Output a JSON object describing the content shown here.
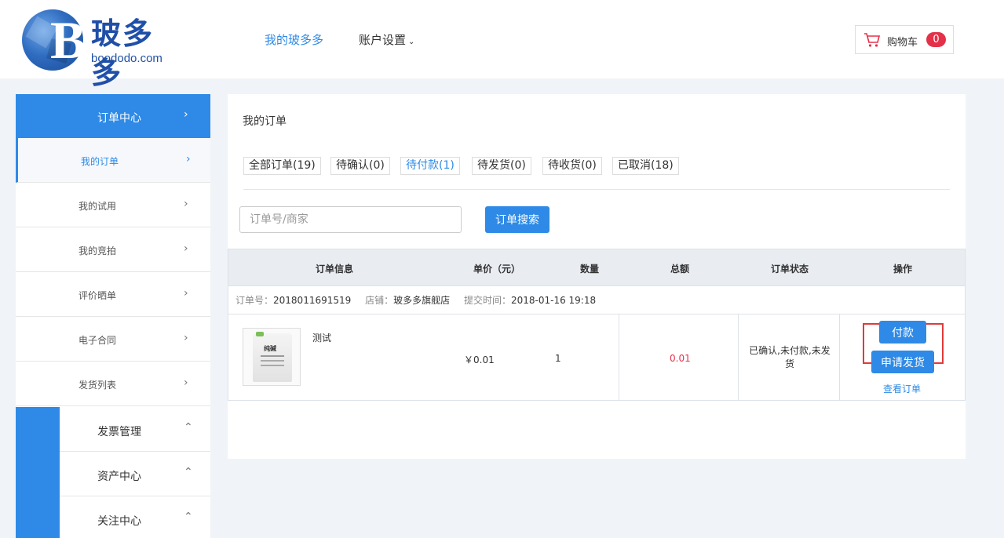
{
  "header": {
    "logo_cn": "玻多多",
    "logo_en": "boododo.com",
    "nav_mine": "我的玻多多",
    "nav_account": "账户设置",
    "cart_label": "购物车",
    "cart_count": "0"
  },
  "sidebar": {
    "top": "订单中心",
    "items": [
      {
        "label": "我的订单",
        "active": true
      },
      {
        "label": "我的试用"
      },
      {
        "label": "我的竞拍"
      },
      {
        "label": "评价晒单"
      },
      {
        "label": "电子合同"
      },
      {
        "label": "发货列表"
      }
    ],
    "groups": [
      "发票管理",
      "资产中心",
      "关注中心"
    ]
  },
  "main": {
    "title": "我的订单",
    "tabs": [
      "全部订单(19)",
      "待确认(0)",
      "待付款(1)",
      "待发货(0)",
      "待收货(0)",
      "已取消(18)"
    ],
    "search_placeholder": "订单号/商家",
    "search_button": "订单搜索",
    "table_headers": [
      "订单信息",
      "单价（元）",
      "数量",
      "总额",
      "订单状态",
      "操作"
    ],
    "order": {
      "no_label": "订单号：",
      "no": "2018011691519",
      "shop_label": "店铺：",
      "shop": "玻多多旗舰店",
      "time_label": "提交时间：",
      "time": "2018-01-16 19:18",
      "product_name": "测试",
      "bag_text": "纯碱",
      "price": "￥0.01",
      "qty": "1",
      "total": "0.01",
      "status": "已确认,未付款,未发货",
      "pay_button": "付款",
      "ship_button": "申请发货",
      "view_link": "查看订单"
    }
  },
  "colors": {
    "accent": "#2e8ae6",
    "badge": "#e5304a",
    "highlight": "#e03a3a"
  }
}
